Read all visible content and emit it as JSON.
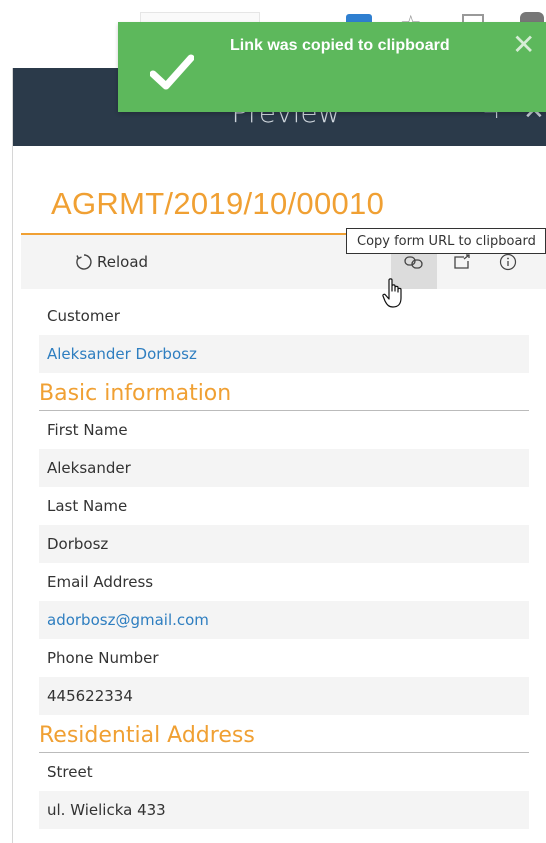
{
  "toast": {
    "message": "Link was copied to clipboard",
    "close_glyph": "✕",
    "color": "#5db85c"
  },
  "panel": {
    "title": "Preview",
    "form_title": "AGRMT/2019/10/00010"
  },
  "toolbar": {
    "reload_label": "Reload",
    "tooltip": "Copy form URL to clipboard"
  },
  "fields": {
    "customer_label": "Customer",
    "customer_value": "Aleksander Dorbosz",
    "section_basic": "Basic information",
    "first_name_label": "First Name",
    "first_name_value": "Aleksander",
    "last_name_label": "Last Name",
    "last_name_value": "Dorbosz",
    "email_label": "Email Address",
    "email_value": "adorbosz@gmail.com",
    "phone_label": "Phone Number",
    "phone_value": "445622334",
    "section_address": "Residential Address",
    "street_label": "Street",
    "street_value": "ul. Wielicka 433"
  },
  "colors": {
    "accent": "#f0a033",
    "link": "#2e7ec0",
    "header_bg": "#2b3a4a"
  },
  "icons": [
    "check-icon",
    "close-icon",
    "reload-icon",
    "link-icon",
    "open-external-icon",
    "info-icon",
    "pin-icon",
    "hand-cursor-icon"
  ]
}
